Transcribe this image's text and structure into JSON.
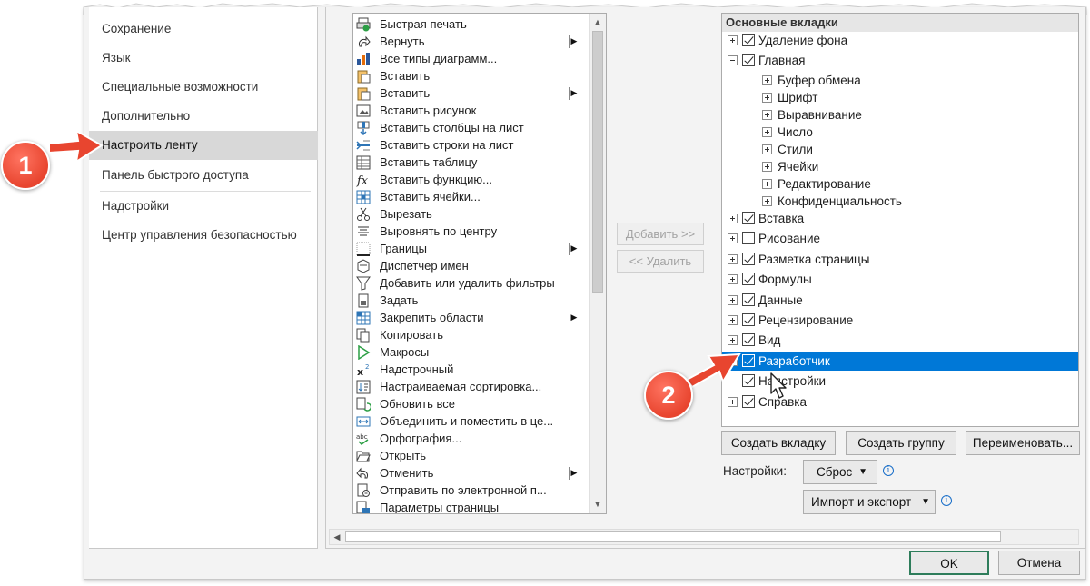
{
  "nav": {
    "items": [
      {
        "label": "Сохранение"
      },
      {
        "label": "Язык"
      },
      {
        "label": "Специальные возможности"
      },
      {
        "label": "Дополнительно"
      },
      {
        "label": "Настроить ленту"
      },
      {
        "label": "Панель быстрого доступа"
      },
      {
        "label": "Надстройки"
      },
      {
        "label": "Центр управления безопасностью"
      }
    ]
  },
  "commands": [
    {
      "label": "Быстрая печать",
      "icon": "quick-print-icon"
    },
    {
      "label": "Вернуть",
      "icon": "redo-icon",
      "submenu": true
    },
    {
      "label": "Все типы диаграмм...",
      "icon": "chart-icon"
    },
    {
      "label": "Вставить",
      "icon": "paste-icon"
    },
    {
      "label": "Вставить",
      "icon": "paste-icon",
      "submenu": true
    },
    {
      "label": "Вставить рисунок",
      "icon": "insert-picture-icon"
    },
    {
      "label": "Вставить столбцы на лист",
      "icon": "insert-columns-icon"
    },
    {
      "label": "Вставить строки на лист",
      "icon": "insert-rows-icon"
    },
    {
      "label": "Вставить таблицу",
      "icon": "table-icon"
    },
    {
      "label": "Вставить функцию...",
      "icon": "function-icon"
    },
    {
      "label": "Вставить ячейки...",
      "icon": "insert-cells-icon"
    },
    {
      "label": "Вырезать",
      "icon": "cut-icon"
    },
    {
      "label": "Выровнять по центру",
      "icon": "align-center-icon"
    },
    {
      "label": "Границы",
      "icon": "borders-icon",
      "submenu": true
    },
    {
      "label": "Диспетчер имен",
      "icon": "name-manager-icon"
    },
    {
      "label": "Добавить или удалить фильтры",
      "icon": "filter-icon"
    },
    {
      "label": "Задать",
      "icon": "set-area-icon"
    },
    {
      "label": "Закрепить области",
      "icon": "freeze-panes-icon",
      "submenu_plain": true
    },
    {
      "label": "Копировать",
      "icon": "copy-icon"
    },
    {
      "label": "Макросы",
      "icon": "macros-icon"
    },
    {
      "label": "Надстрочный",
      "icon": "superscript-icon"
    },
    {
      "label": "Настраиваемая сортировка...",
      "icon": "custom-sort-icon"
    },
    {
      "label": "Обновить все",
      "icon": "refresh-all-icon"
    },
    {
      "label": "Объединить и поместить в це...",
      "icon": "merge-center-icon"
    },
    {
      "label": "Орфография...",
      "icon": "spelling-icon"
    },
    {
      "label": "Открыть",
      "icon": "open-folder-icon"
    },
    {
      "label": "Отменить",
      "icon": "undo-icon",
      "submenu": true
    },
    {
      "label": "Отправить по электронной п...",
      "icon": "email-icon"
    },
    {
      "label": "Параметры страницы",
      "icon": "page-setup-icon"
    }
  ],
  "middle": {
    "add_label": "Добавить >>",
    "remove_label": "<< Удалить"
  },
  "tree": {
    "header": "Основные вкладки",
    "nodes": [
      {
        "label": "Удаление фона",
        "level": 0,
        "expand": "plus",
        "checked": true
      },
      {
        "label": "Главная",
        "level": 0,
        "expand": "minus",
        "checked": true
      },
      {
        "label": "Буфер обмена",
        "level": 1,
        "expand": "plus"
      },
      {
        "label": "Шрифт",
        "level": 1,
        "expand": "plus"
      },
      {
        "label": "Выравнивание",
        "level": 1,
        "expand": "plus"
      },
      {
        "label": "Число",
        "level": 1,
        "expand": "plus"
      },
      {
        "label": "Стили",
        "level": 1,
        "expand": "plus"
      },
      {
        "label": "Ячейки",
        "level": 1,
        "expand": "plus"
      },
      {
        "label": "Редактирование",
        "level": 1,
        "expand": "plus"
      },
      {
        "label": "Конфиденциальность",
        "level": 1,
        "expand": "plus"
      },
      {
        "label": "Вставка",
        "level": 0,
        "expand": "plus",
        "checked": true
      },
      {
        "label": "Рисование",
        "level": 0,
        "expand": "plus",
        "checked": false
      },
      {
        "label": "Разметка страницы",
        "level": 0,
        "expand": "plus",
        "checked": true
      },
      {
        "label": "Формулы",
        "level": 0,
        "expand": "plus",
        "checked": true
      },
      {
        "label": "Данные",
        "level": 0,
        "expand": "plus",
        "checked": true
      },
      {
        "label": "Рецензирование",
        "level": 0,
        "expand": "plus",
        "checked": true
      },
      {
        "label": "Вид",
        "level": 0,
        "expand": "plus",
        "checked": true
      },
      {
        "label": "Разработчик",
        "level": 0,
        "expand": "plus",
        "checked": true,
        "selected": true
      },
      {
        "label": "Надстройки",
        "level": 0,
        "expand": "none",
        "checked": true
      },
      {
        "label": "Справка",
        "level": 0,
        "expand": "plus",
        "checked": true
      }
    ]
  },
  "buttons": {
    "new_tab": "Создать вкладку",
    "new_group": "Создать группу",
    "rename": "Переименовать...",
    "settings_label": "Настройки:",
    "reset": "Сброс",
    "import_export": "Импорт и экспорт",
    "ok": "OK",
    "cancel": "Отмена"
  },
  "callouts": [
    "1",
    "2"
  ],
  "colors": {
    "selection": "#0078d7",
    "callout": "#e8452f",
    "ok_border": "#2e7d5b"
  }
}
